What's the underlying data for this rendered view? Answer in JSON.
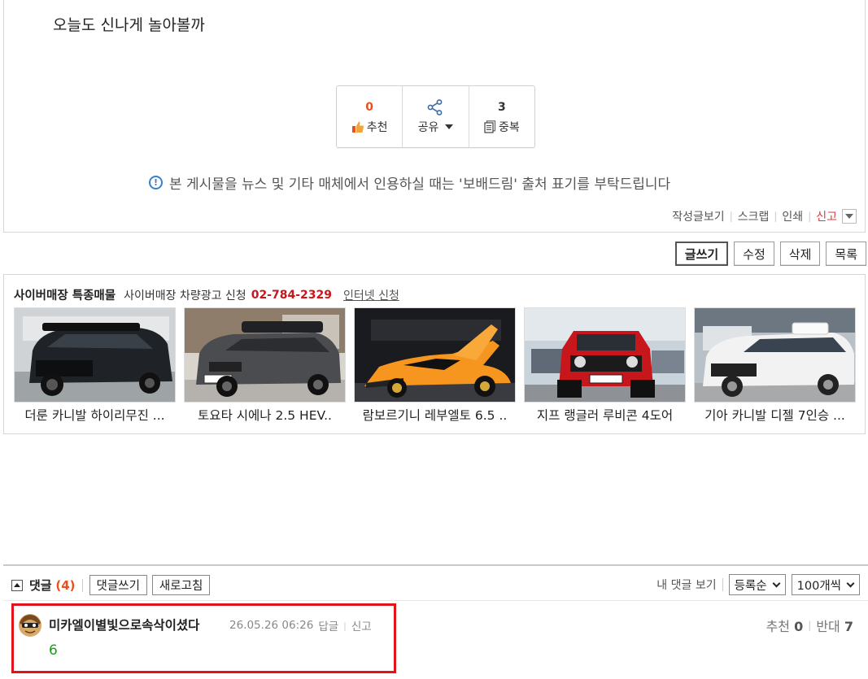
{
  "post": {
    "body": "오늘도 신나게 놀아볼까",
    "actions": {
      "recommend_count": "0",
      "recommend_label": "추천",
      "share_label": "공유",
      "duplicate_count": "3",
      "duplicate_label": "중복"
    },
    "notice": "본 게시물을 뉴스 및 기타 매체에서 인용하실 때는 '보배드림' 출처 표기를 부탁드립니다",
    "links": {
      "view_posts": "작성글보기",
      "scrap": "스크랩",
      "print": "인쇄",
      "report": "신고"
    }
  },
  "toolbar": {
    "write": "글쓰기",
    "edit": "수정",
    "delete": "삭제",
    "list": "목록"
  },
  "market": {
    "title": "사이버매장 특종매물",
    "ad_text": "사이버매장 차량광고 신청",
    "phone": "02-784-2329",
    "apply_link": "인터넷 신청",
    "cars": [
      {
        "caption": "더룬 카니발 하이리무진 ...",
        "color": "#1f2227"
      },
      {
        "caption": "토요타 시에나 2.5 HEV..",
        "color": "#4a4c50"
      },
      {
        "caption": "람보르기니 레부엘토 6.5 ..",
        "color": "#f7961e"
      },
      {
        "caption": "지프 랭글러 루비콘 4도어",
        "color": "#c8161d"
      },
      {
        "caption": "기아 카니발 디젤 7인승 ...",
        "color": "#f2f2f2"
      }
    ]
  },
  "comments": {
    "title": "댓글",
    "count": "(4)",
    "write_btn": "댓글쓰기",
    "refresh_btn": "새로고침",
    "my_comments": "내 댓글 보기",
    "sort_select": "등록순",
    "per_page_select": "100개씩",
    "items": [
      {
        "author": "미카엘이별빛으로속삭이셨다",
        "date": "26.05.26 06:26",
        "reply": "답글",
        "report": "신고",
        "text": "6",
        "recommend_label": "추천",
        "recommend": "0",
        "oppose_label": "반대",
        "oppose": "7"
      }
    ]
  },
  "colors": {
    "accent_orange": "#e8501f",
    "phone_red": "#c8161d",
    "highlight_red": "#e0141b",
    "comment_green": "#1a9b1a",
    "notice_blue": "#3a82c4"
  }
}
